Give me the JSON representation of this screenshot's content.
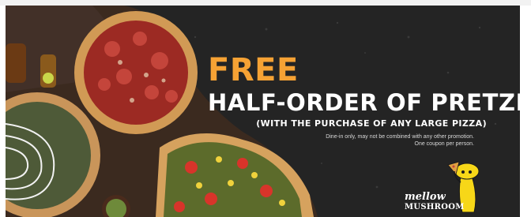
{
  "promo": {
    "headline_free": "FREE",
    "headline_main": "HALF-ORDER OF PRETZELS",
    "subhead": "(WITH THE PURCHASE OF ANY LARGE PIZZA)",
    "fine_print_line1": "Dine-in only, may not be combined with any other promotion.",
    "fine_print_line2": "One coupon per person."
  },
  "brand": {
    "logo_script": "mellow",
    "logo_block": "MUSHROOM"
  },
  "colors": {
    "background": "#242424",
    "accent_orange": "#f6a234",
    "text_white": "#ffffff",
    "mascot_yellow": "#f7d718"
  },
  "icons": [
    "pizza-image",
    "mushroom-mascot-icon"
  ]
}
